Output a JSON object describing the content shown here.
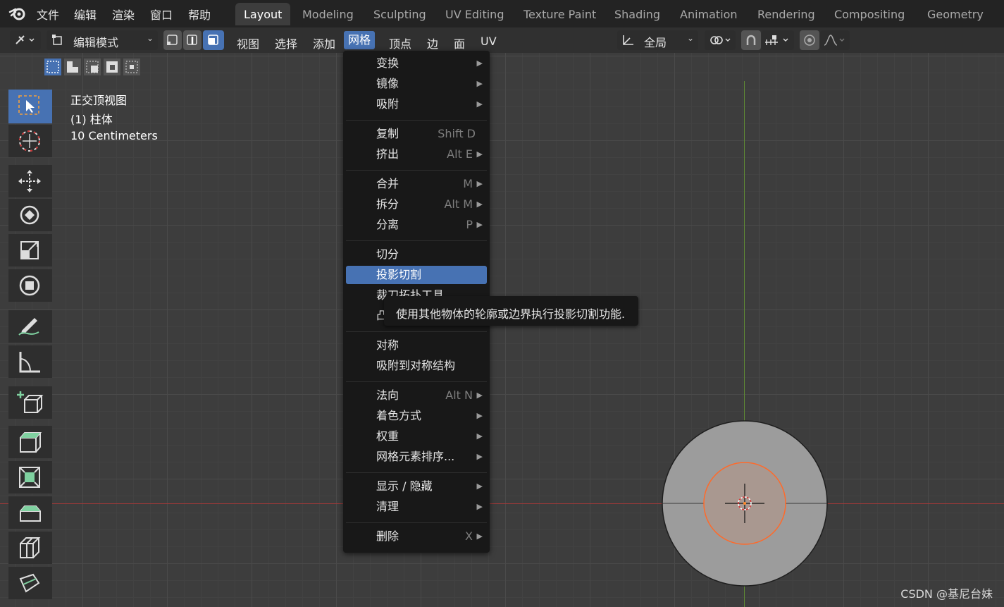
{
  "app": {
    "top_menu": [
      "文件",
      "编辑",
      "渲染",
      "窗口",
      "帮助"
    ],
    "workspace_tabs": [
      "Layout",
      "Modeling",
      "Sculpting",
      "UV Editing",
      "Texture Paint",
      "Shading",
      "Animation",
      "Rendering",
      "Compositing",
      "Geometry Nodes"
    ],
    "active_tab": "Layout"
  },
  "header": {
    "mode": "编辑模式",
    "menus": [
      "视图",
      "选择",
      "添加",
      "网格",
      "顶点",
      "边",
      "面",
      "UV"
    ],
    "active_menu": "网格",
    "transform_orientation": "全局"
  },
  "viewport": {
    "view_name": "正交顶视图",
    "object_name": "(1) 柱体",
    "scale_label": "10 Centimeters"
  },
  "mesh_menu": {
    "items": [
      {
        "label": "变换",
        "shortcut": "",
        "submenu": true
      },
      {
        "label": "镜像",
        "shortcut": "",
        "submenu": true
      },
      {
        "label": "吸附",
        "shortcut": "",
        "submenu": true
      },
      {
        "label": "复制",
        "shortcut": "Shift D",
        "submenu": false
      },
      {
        "label": "挤出",
        "shortcut": "Alt E",
        "submenu": true
      },
      {
        "label": "合并",
        "shortcut": "M",
        "submenu": true
      },
      {
        "label": "拆分",
        "shortcut": "Alt M",
        "submenu": true
      },
      {
        "label": "分离",
        "shortcut": "P",
        "submenu": true
      },
      {
        "label": "切分",
        "shortcut": "",
        "submenu": false
      },
      {
        "label": "投影切割",
        "shortcut": "",
        "submenu": false
      },
      {
        "label": "裁刀拓扑工具",
        "shortcut": "",
        "submenu": false
      },
      {
        "label": "凸包",
        "shortcut": "",
        "submenu": false
      },
      {
        "label": "对称",
        "shortcut": "",
        "submenu": false
      },
      {
        "label": "吸附到对称结构",
        "shortcut": "",
        "submenu": false
      },
      {
        "label": "法向",
        "shortcut": "Alt N",
        "submenu": true
      },
      {
        "label": "着色方式",
        "shortcut": "",
        "submenu": true
      },
      {
        "label": "权重",
        "shortcut": "",
        "submenu": true
      },
      {
        "label": "网格元素排序...",
        "shortcut": "",
        "submenu": true
      },
      {
        "label": "显示 / 隐藏",
        "shortcut": "",
        "submenu": true
      },
      {
        "label": "清理",
        "shortcut": "",
        "submenu": true
      },
      {
        "label": "删除",
        "shortcut": "X",
        "submenu": true
      }
    ],
    "highlighted": "投影切割",
    "tooltip": "使用其他物体的轮廓或边界执行投影切割功能."
  },
  "watermark": "CSDN @基尼台妹",
  "colors": {
    "accent": "#4772b3",
    "menu_bg": "#181818",
    "viewport_bg": "#3d3d3d",
    "x_axis": "#a23838",
    "y_axis": "#5f8a35"
  }
}
